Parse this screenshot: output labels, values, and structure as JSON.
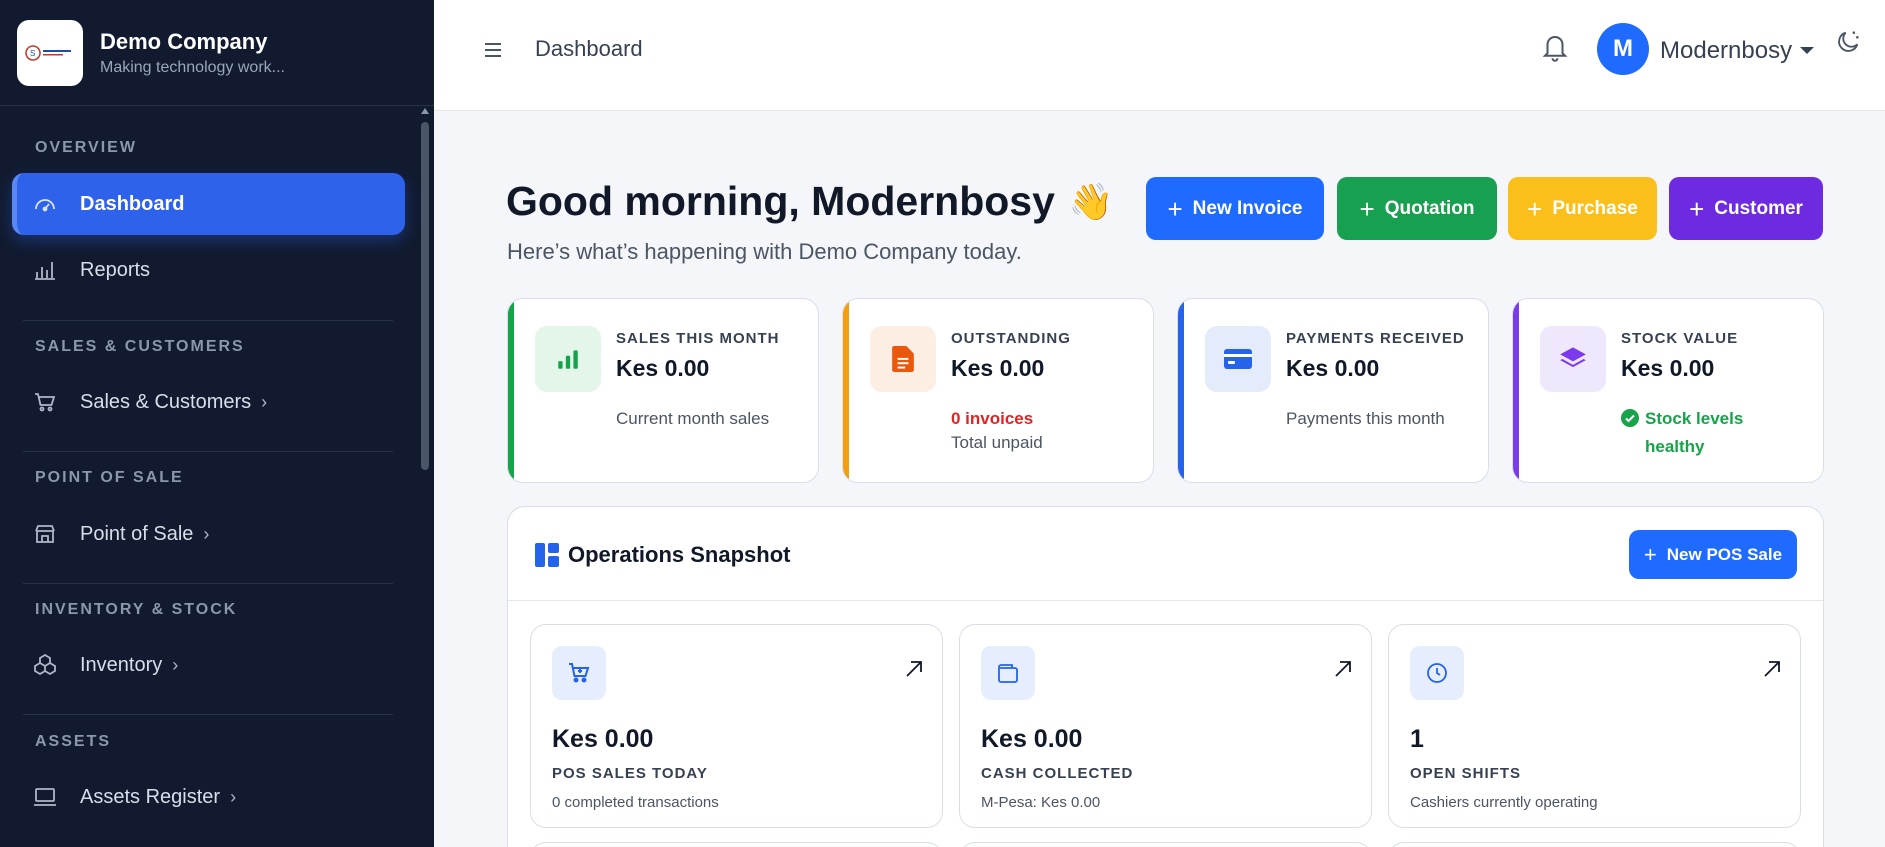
{
  "brand": {
    "name": "Demo Company",
    "tagline": "Making technology work...",
    "logo_icon": "company-logo"
  },
  "sidebar": {
    "sections": [
      {
        "title": "OVERVIEW"
      },
      {
        "title": "SALES & CUSTOMERS"
      },
      {
        "title": "POINT OF SALE"
      },
      {
        "title": "INVENTORY & STOCK"
      },
      {
        "title": "ASSETS"
      }
    ],
    "items": [
      {
        "label": "Dashboard",
        "icon": "gauge-icon",
        "active": true
      },
      {
        "label": "Reports",
        "icon": "bar-chart-icon"
      },
      {
        "label": "Sales & Customers",
        "icon": "cart-icon",
        "chevron": "›"
      },
      {
        "label": "Point of Sale",
        "icon": "shop-icon",
        "chevron": "›"
      },
      {
        "label": "Inventory",
        "icon": "boxes-icon",
        "chevron": "›"
      },
      {
        "label": "Assets Register",
        "icon": "laptop-icon",
        "chevron": "›"
      }
    ]
  },
  "header": {
    "title": "Dashboard",
    "avatar_initial": "M",
    "username": "Modernbosy"
  },
  "main": {
    "greeting": "Good morning, Modernbosy",
    "wave": "👋",
    "subgreeting": "Here’s what’s happening with Demo Company today.",
    "actions": [
      {
        "label": "New Invoice",
        "color": "#1f6bff"
      },
      {
        "label": "Quotation",
        "color": "#16a050"
      },
      {
        "label": "Purchase",
        "color": "#fbbf1c"
      },
      {
        "label": "Customer",
        "color": "#6d2ae0"
      }
    ],
    "stats": [
      {
        "label": "SALES THIS MONTH",
        "value": "Kes 0.00",
        "sub": "Current month sales",
        "accent": "#16a34a",
        "icon": "bar-chart-icon"
      },
      {
        "label": "OUTSTANDING",
        "value": "Kes 0.00",
        "sub_alert": "0 invoices",
        "sub": "Total unpaid",
        "accent": "#f59e0b",
        "icon": "document-icon"
      },
      {
        "label": "PAYMENTS RECEIVED",
        "value": "Kes 0.00",
        "sub": "Payments this month",
        "accent": "#2563eb",
        "icon": "credit-card-icon"
      },
      {
        "label": "STOCK VALUE",
        "value": "Kes 0.00",
        "sub_ok": "Stock levels healthy",
        "accent": "#7c3aed",
        "icon": "layers-icon"
      }
    ],
    "operations": {
      "title": "Operations Snapshot",
      "new_pos_label": "New POS Sale",
      "cards": [
        {
          "value": "Kes 0.00",
          "label": "POS SALES TODAY",
          "sub": "0 completed transactions",
          "icon": "cart-icon"
        },
        {
          "value": "Kes 0.00",
          "label": "CASH COLLECTED",
          "sub": "M-Pesa: Kes 0.00",
          "icon": "wallet-icon"
        },
        {
          "value": "1",
          "label": "OPEN SHIFTS",
          "sub": "Cashiers currently operating",
          "icon": "clock-icon"
        }
      ]
    }
  }
}
